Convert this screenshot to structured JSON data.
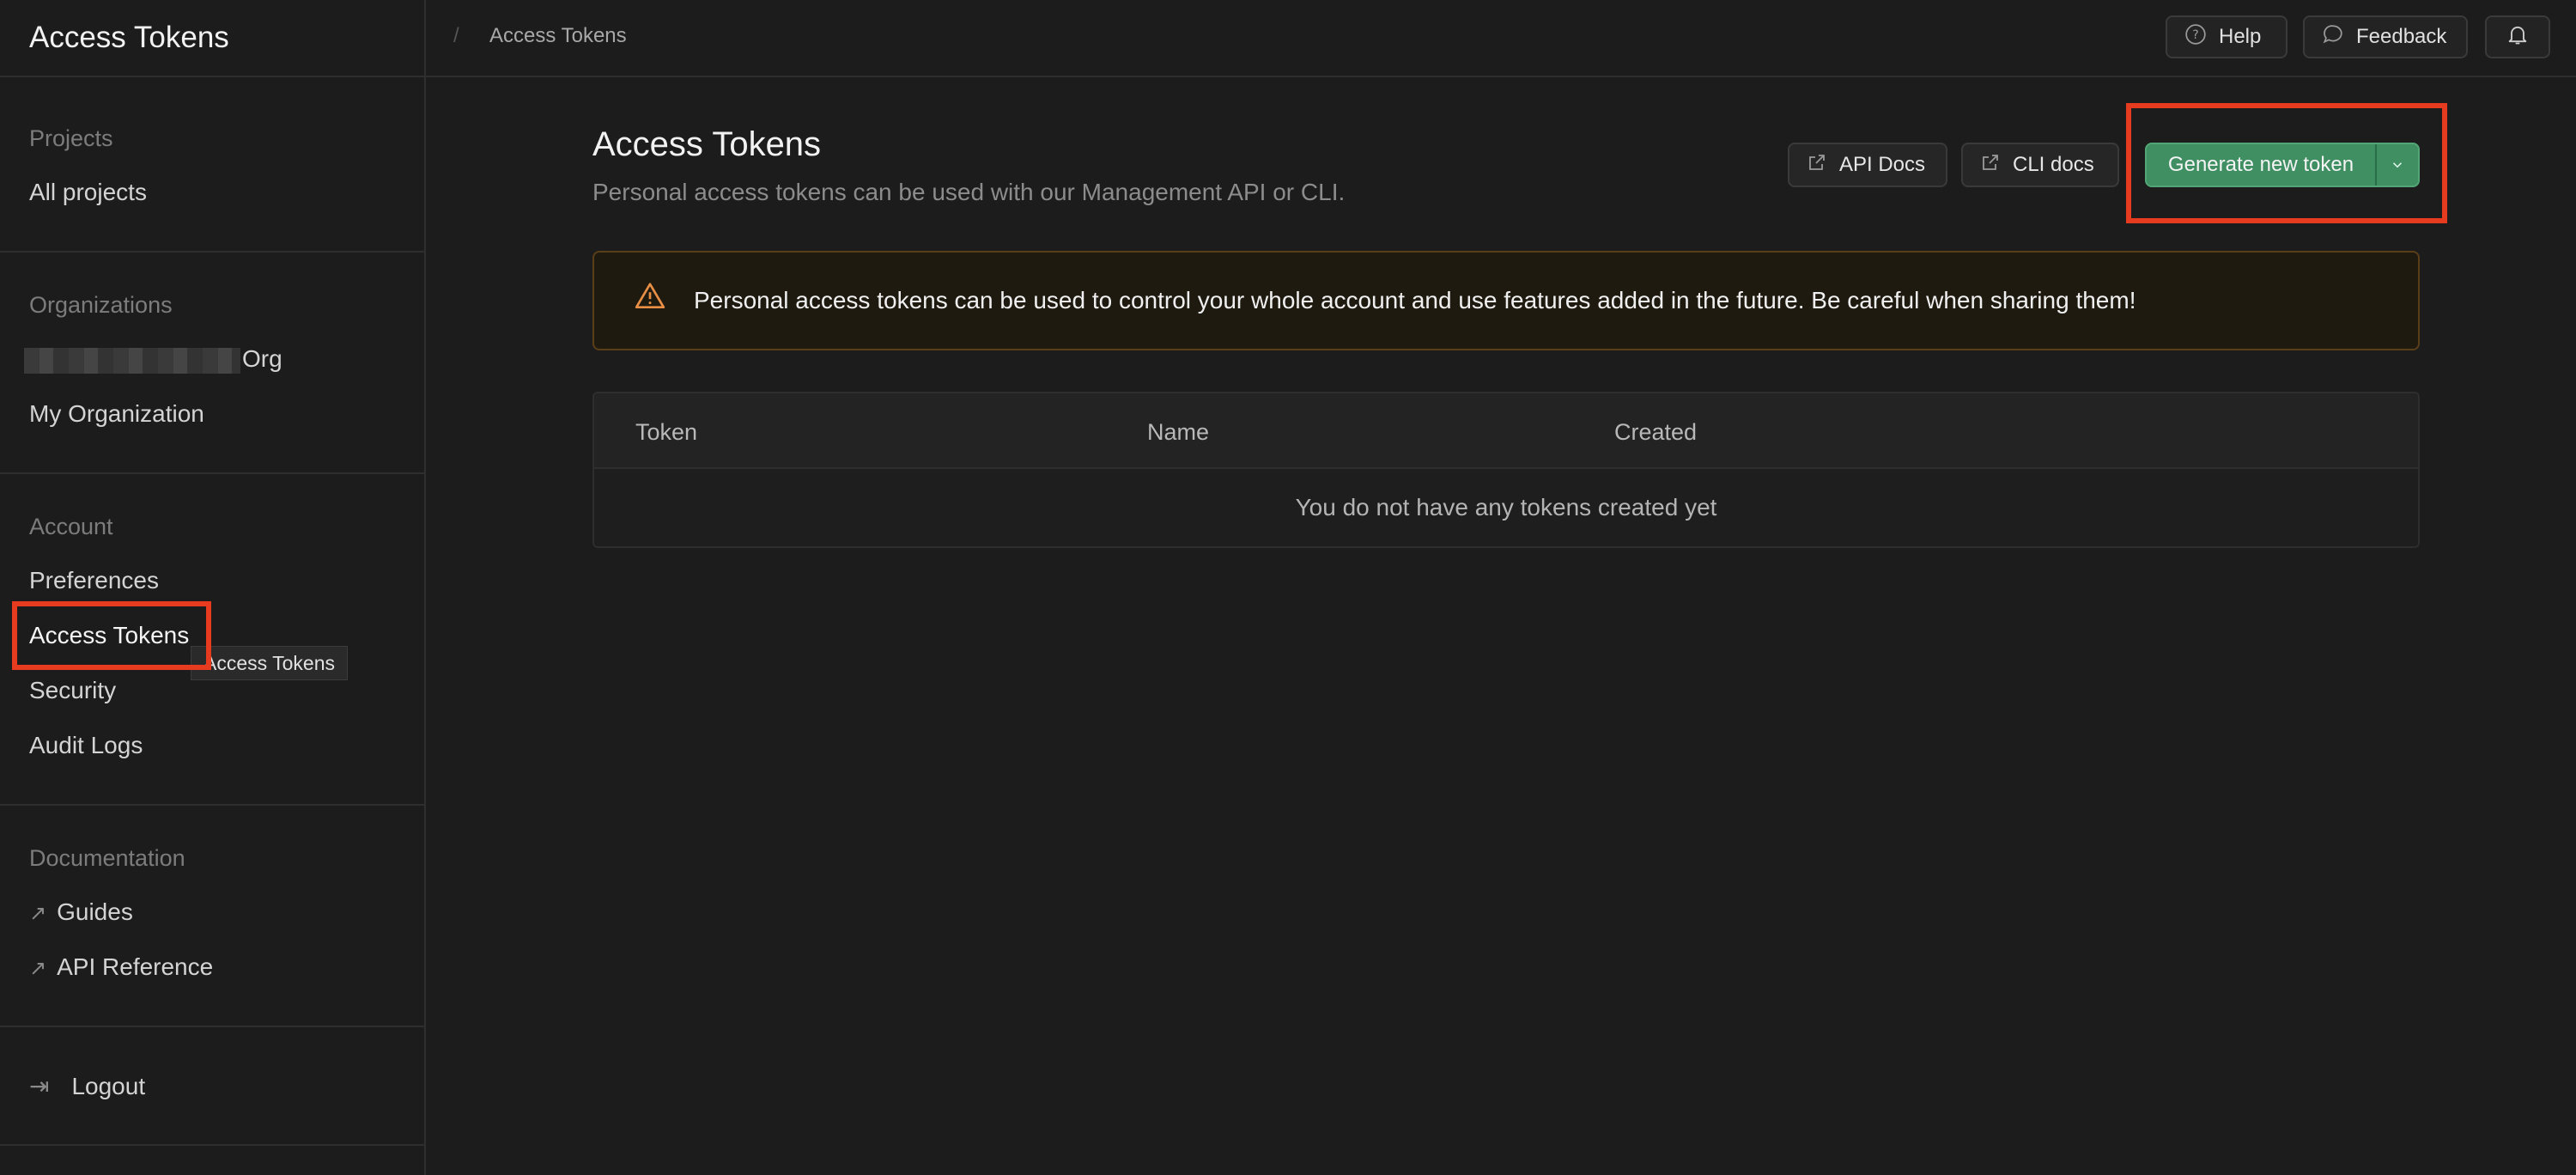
{
  "sidebar": {
    "header_title": "Access Tokens",
    "projects": {
      "title": "Projects",
      "items": [
        "All projects"
      ]
    },
    "organizations": {
      "title": "Organizations",
      "items": [
        {
          "label": "Org",
          "redacted": true
        },
        {
          "label": "My Organization"
        }
      ]
    },
    "account": {
      "title": "Account",
      "items": [
        "Preferences",
        "Access Tokens",
        "Security",
        "Audit Logs"
      ],
      "active": "Access Tokens"
    },
    "documentation": {
      "title": "Documentation",
      "items": [
        "Guides",
        "API Reference"
      ]
    },
    "logout_label": "Logout",
    "tooltip": "Access Tokens"
  },
  "topbar": {
    "breadcrumb": "Access Tokens",
    "help_label": "Help",
    "feedback_label": "Feedback"
  },
  "main": {
    "title": "Access Tokens",
    "subtitle": "Personal access tokens can be used with our Management API or CLI.",
    "api_docs_label": "API Docs",
    "cli_docs_label": "CLI docs",
    "generate_label": "Generate new token",
    "warning": "Personal access tokens can be used to control your whole account and use features added in the future. Be careful when sharing them!",
    "table": {
      "columns": [
        "Token",
        "Name",
        "Created"
      ],
      "empty_message": "You do not have any tokens created yet"
    }
  },
  "colors": {
    "background": "#1c1c1c",
    "accent_green": "#3f8f63",
    "warning_orange": "#e88f45",
    "highlight_red": "#e63b1e"
  },
  "icons": [
    "question-icon",
    "chat-bubble-icon",
    "bell-icon",
    "external-link-icon",
    "chevron-down-icon",
    "warning-triangle-icon",
    "arrow-up-right-icon",
    "logout-icon"
  ]
}
